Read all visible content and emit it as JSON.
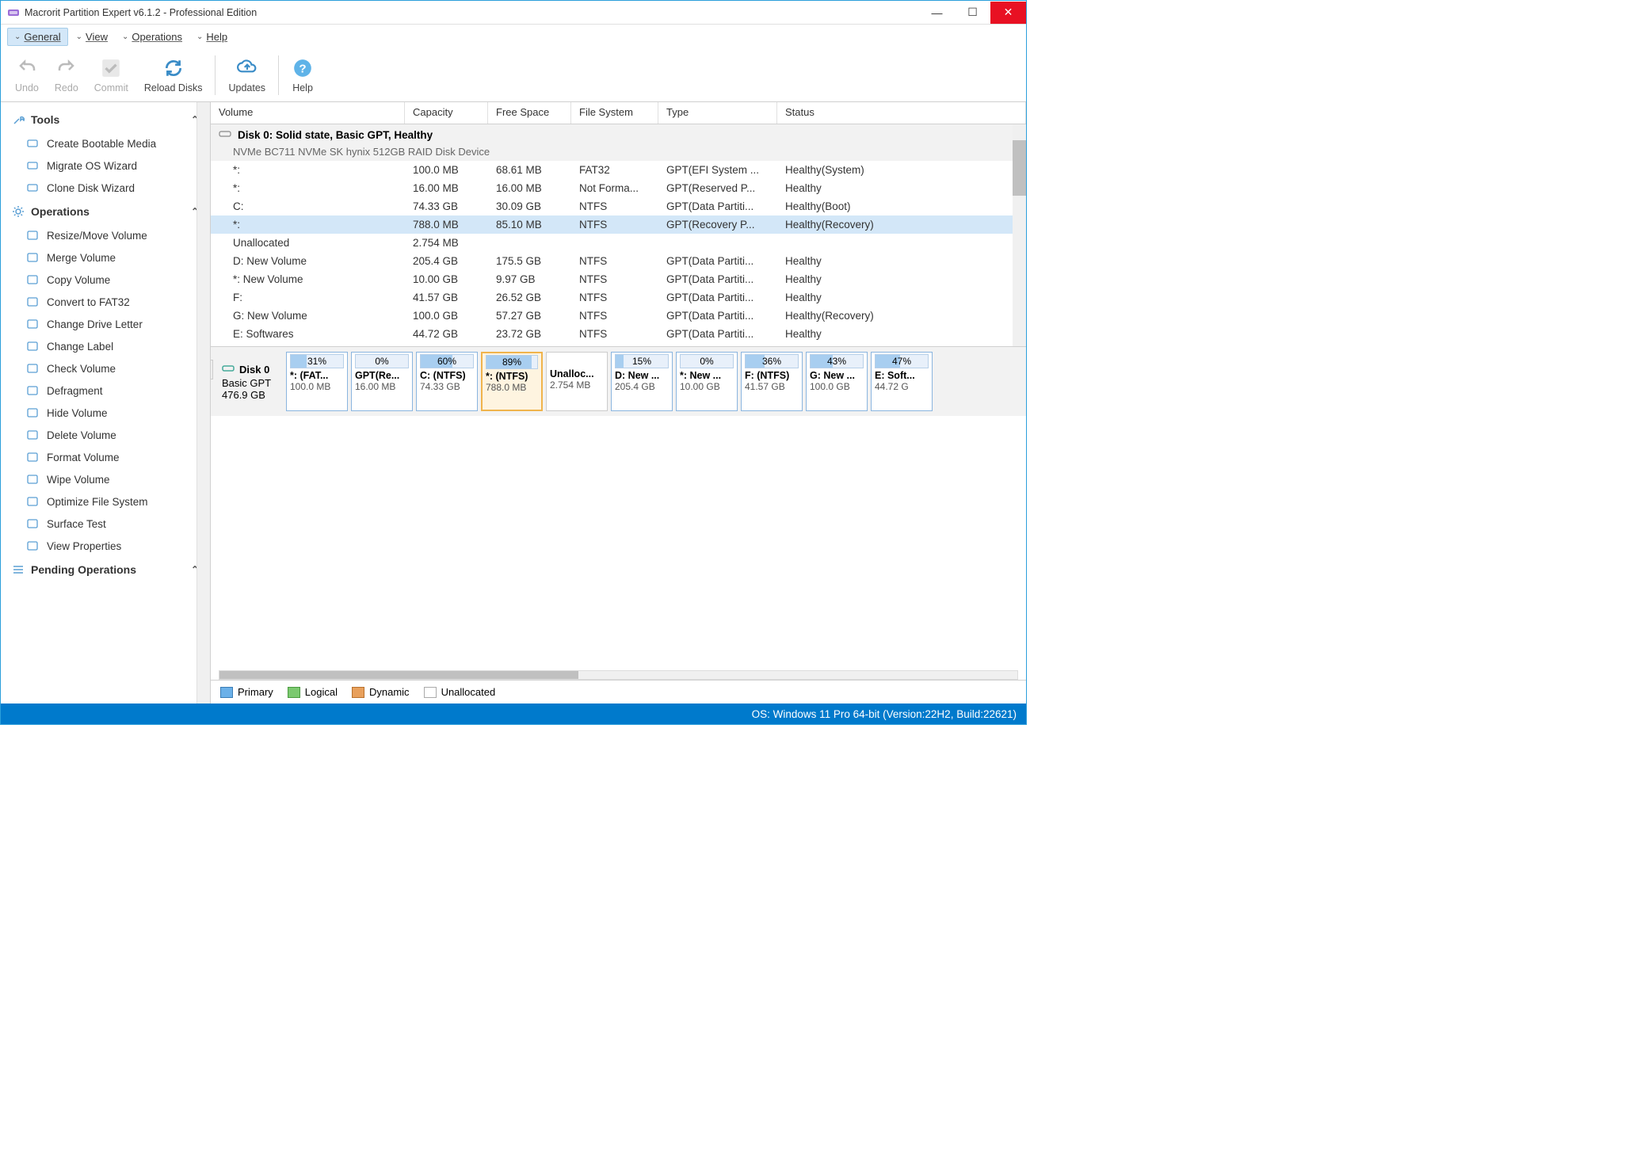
{
  "window": {
    "title": "Macrorit Partition Expert v6.1.2 - Professional Edition"
  },
  "menubar": {
    "items": [
      {
        "label": "General",
        "active": true
      },
      {
        "label": "View",
        "active": false
      },
      {
        "label": "Operations",
        "active": false
      },
      {
        "label": "Help",
        "active": false
      }
    ]
  },
  "toolbar": {
    "undo": "Undo",
    "redo": "Redo",
    "commit": "Commit",
    "reload": "Reload Disks",
    "updates": "Updates",
    "help": "Help"
  },
  "sidebar": {
    "tools": {
      "title": "Tools",
      "items": [
        "Create Bootable Media",
        "Migrate OS Wizard",
        "Clone Disk Wizard"
      ]
    },
    "operations": {
      "title": "Operations",
      "items": [
        "Resize/Move Volume",
        "Merge Volume",
        "Copy Volume",
        "Convert to FAT32",
        "Change Drive Letter",
        "Change Label",
        "Check Volume",
        "Defragment",
        "Hide Volume",
        "Delete Volume",
        "Format Volume",
        "Wipe Volume",
        "Optimize File System",
        "Surface Test",
        "View Properties"
      ]
    },
    "pending": {
      "title": "Pending Operations"
    }
  },
  "grid": {
    "headers": {
      "volume": "Volume",
      "capacity": "Capacity",
      "free": "Free Space",
      "fs": "File System",
      "type": "Type",
      "status": "Status"
    },
    "disk": {
      "title": "Disk 0: Solid state, Basic GPT, Healthy",
      "subtitle": "NVMe BC711 NVMe SK hynix 512GB RAID Disk Device"
    },
    "rows": [
      {
        "vol": "*:",
        "cap": "100.0 MB",
        "free": "68.61 MB",
        "fs": "FAT32",
        "type": "GPT(EFI System ...",
        "status": "Healthy(System)",
        "selected": false
      },
      {
        "vol": "*:",
        "cap": "16.00 MB",
        "free": "16.00 MB",
        "fs": "Not Forma...",
        "type": "GPT(Reserved P...",
        "status": "Healthy",
        "selected": false
      },
      {
        "vol": "C:",
        "cap": "74.33 GB",
        "free": "30.09 GB",
        "fs": "NTFS",
        "type": "GPT(Data Partiti...",
        "status": "Healthy(Boot)",
        "selected": false
      },
      {
        "vol": "*:",
        "cap": "788.0 MB",
        "free": "85.10 MB",
        "fs": "NTFS",
        "type": "GPT(Recovery P...",
        "status": "Healthy(Recovery)",
        "selected": true
      },
      {
        "vol": "Unallocated",
        "cap": "2.754 MB",
        "free": "",
        "fs": "",
        "type": "",
        "status": "",
        "selected": false
      },
      {
        "vol": "D: New Volume",
        "cap": "205.4 GB",
        "free": "175.5 GB",
        "fs": "NTFS",
        "type": "GPT(Data Partiti...",
        "status": "Healthy",
        "selected": false
      },
      {
        "vol": "*: New Volume",
        "cap": "10.00 GB",
        "free": "9.97 GB",
        "fs": "NTFS",
        "type": "GPT(Data Partiti...",
        "status": "Healthy",
        "selected": false
      },
      {
        "vol": "F:",
        "cap": "41.57 GB",
        "free": "26.52 GB",
        "fs": "NTFS",
        "type": "GPT(Data Partiti...",
        "status": "Healthy",
        "selected": false
      },
      {
        "vol": "G: New Volume",
        "cap": "100.0 GB",
        "free": "57.27 GB",
        "fs": "NTFS",
        "type": "GPT(Data Partiti...",
        "status": "Healthy(Recovery)",
        "selected": false
      },
      {
        "vol": "E: Softwares",
        "cap": "44.72 GB",
        "free": "23.72 GB",
        "fs": "NTFS",
        "type": "GPT(Data Partiti...",
        "status": "Healthy",
        "selected": false
      }
    ],
    "ellipsis_fs": "....."
  },
  "diskmap": {
    "disk": {
      "name": "Disk 0",
      "type": "Basic GPT",
      "size": "476.9 GB"
    },
    "parts": [
      {
        "pct": "31%",
        "label": "*: (FAT...",
        "size": "100.0 MB",
        "fill": 31,
        "selected": false,
        "unalloc": false
      },
      {
        "pct": "0%",
        "label": "GPT(Re...",
        "size": "16.00 MB",
        "fill": 0,
        "selected": false,
        "unalloc": false
      },
      {
        "pct": "60%",
        "label": "C: (NTFS)",
        "size": "74.33 GB",
        "fill": 60,
        "selected": false,
        "unalloc": false
      },
      {
        "pct": "89%",
        "label": "*: (NTFS)",
        "size": "788.0 MB",
        "fill": 89,
        "selected": true,
        "unalloc": false
      },
      {
        "pct": "",
        "label": "Unalloc...",
        "size": "2.754 MB",
        "fill": 0,
        "selected": false,
        "unalloc": true
      },
      {
        "pct": "15%",
        "label": "D: New ...",
        "size": "205.4 GB",
        "fill": 15,
        "selected": false,
        "unalloc": false
      },
      {
        "pct": "0%",
        "label": "*: New ...",
        "size": "10.00 GB",
        "fill": 0,
        "selected": false,
        "unalloc": false
      },
      {
        "pct": "36%",
        "label": "F: (NTFS)",
        "size": "41.57 GB",
        "fill": 36,
        "selected": false,
        "unalloc": false
      },
      {
        "pct": "43%",
        "label": "G: New ...",
        "size": "100.0 GB",
        "fill": 43,
        "selected": false,
        "unalloc": false
      },
      {
        "pct": "47%",
        "label": "E: Soft...",
        "size": "44.72 G",
        "fill": 47,
        "selected": false,
        "unalloc": false
      }
    ]
  },
  "legend": {
    "primary": "Primary",
    "logical": "Logical",
    "dynamic": "Dynamic",
    "unallocated": "Unallocated"
  },
  "statusbar": {
    "text": "OS: Windows 11 Pro 64-bit (Version:22H2, Build:22621)"
  },
  "colors": {
    "accent": "#007acc",
    "selection": "#d3e7f8",
    "primary_swatch": "#6bb0e8",
    "logical_swatch": "#7bc96f",
    "dynamic_swatch": "#e8a05c"
  }
}
